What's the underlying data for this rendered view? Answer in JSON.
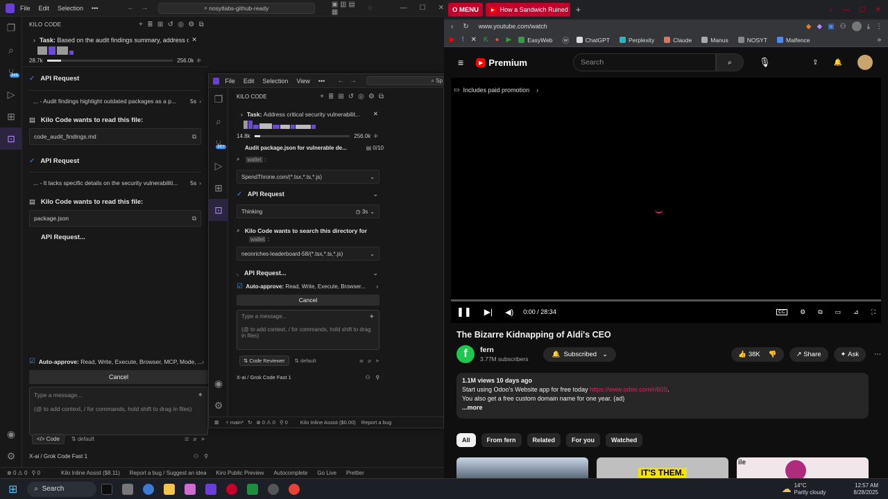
{
  "left_editor": {
    "menu": [
      "File",
      "Edit",
      "Selection"
    ],
    "search": "nosytlabs-github-ready",
    "panel_title": "KILO CODE",
    "task_label": "Task:",
    "task_text": "Based on the audit findings summary, address cri...",
    "token_in": "28.7k",
    "token_max": "256.0k",
    "token_fill": 0.11,
    "badge": "346",
    "items": [
      {
        "type": "api",
        "label": "API Request"
      },
      {
        "type": "box",
        "text": "... - Audit findings highlight outdated packages as a p...",
        "time": "5s"
      },
      {
        "type": "read",
        "label": "Kilo Code wants to read this file:"
      },
      {
        "type": "file",
        "text": "code_audit_findings.md"
      },
      {
        "type": "api",
        "label": "API Request"
      },
      {
        "type": "box",
        "text": "... - It lacks specific details on the security vulnerabiliti...",
        "time": "5s"
      },
      {
        "type": "read",
        "label": "Kilo Code wants to read this file:"
      },
      {
        "type": "file",
        "text": "package.json"
      },
      {
        "type": "pending",
        "label": "API Request..."
      }
    ],
    "auto_approve_label": "Auto-approve:",
    "auto_approve_value": "Read, Write, Execute, Browser, MCP, Mode, ...",
    "cancel": "Cancel",
    "msg_placeholder": "Type a message...",
    "msg_hint": "(@ to add context, / for commands, hold shift to drag in files)",
    "mode": "Code",
    "profile": "default",
    "model": "X-ai / Grok Code Fast 1",
    "status": [
      "0 ⚠ 0",
      "0",
      "Kilo Inline Assist ($8.11)",
      "Report a bug / Suggest an idea",
      "Kiro Public Preview",
      "Autocomplete",
      "Go Live",
      "Prettier"
    ]
  },
  "second_editor": {
    "menu": [
      "File",
      "Edit",
      "Selection",
      "View"
    ],
    "search": "Sp",
    "panel_title": "KILO CODE",
    "task_label": "Task:",
    "task_text": "Address critical security vulnerabilit...",
    "token_in": "14.8k",
    "token_max": "256.0k",
    "token_fill": 0.06,
    "badge": "1K+",
    "todo_text": "Audit package.json for vulnerable de...",
    "todo_count": "0/10",
    "wallet_word": "wallet",
    "pattern1": "SpendThrone.com/(*.tsx,*.ts,*.js)",
    "api_request": "API Request",
    "thinking": "Thinking",
    "thinking_time": "3s",
    "search_label": "Kilo Code wants to search this directory for",
    "pattern2": "neonriches-leaderboard-58/(*.tsx,*.ts,*.js)",
    "api_pending": "API Request...",
    "auto_approve_label": "Auto-approve:",
    "auto_approve_value": "Read, Write, Execute, Browser...",
    "cancel": "Cancel",
    "msg_placeholder": "Type a message...",
    "msg_hint": "(@ to add context, / for commands, hold shift to drag in files)",
    "mode": "Code Reviewer",
    "profile": "default",
    "model": "X-ai / Grok Code Fast 1",
    "status": [
      "main*",
      "0 ⚠ 0",
      "0",
      "Kilo Inline Assist ($0.00)",
      "Report a bug"
    ]
  },
  "browser": {
    "tabs": [
      {
        "label": "MENU"
      },
      {
        "label": "How a Sandwich Ruined ×"
      }
    ],
    "new_tab": "+",
    "url": "www.youtube.com/watch",
    "bookmarks": [
      {
        "label": "EasyWeb",
        "color": "#2ea043"
      },
      {
        "label": "ChatGPT",
        "color": "#dddddd"
      },
      {
        "label": "Perplexity",
        "color": "#20b8cd"
      },
      {
        "label": "Claude",
        "color": "#d97757"
      },
      {
        "label": "Manus",
        "color": "#aaaaaa"
      },
      {
        "label": "NOSYT",
        "color": "#888888"
      },
      {
        "label": "Malfence",
        "color": "#4c8bf5"
      }
    ],
    "yt_brand": "Premium",
    "search_placeholder": "Search",
    "paid_promo": "Includes paid promotion",
    "time": "0:00 / 28:34",
    "title": "The Bizarre Kidnapping of Aldi's CEO",
    "channel": "fern",
    "subs": "3.77M subscribers",
    "subscribed": "Subscribed",
    "likes": "38K",
    "share": "Share",
    "ask": "Ask",
    "views": "1.1M views  10 days ago",
    "desc1_prefix": "Start using Odoo's Website app for free today ",
    "desc1_link": "https://www.odoo.com/r/60S",
    "desc2": "You also get a free custom domain name for one year. (ad)",
    "more": "...more",
    "chips": [
      "All",
      "From fern",
      "Related",
      "For you",
      "Watched"
    ],
    "thumb_text": "IT'S THEM.",
    "thumb_side_text": "ile",
    "progress": 0.0
  },
  "taskbar": {
    "search": "Search",
    "weather_temp": "14°C",
    "weather_desc": "Partly cloudy",
    "time": "12:57 AM",
    "date": "8/28/2025"
  }
}
